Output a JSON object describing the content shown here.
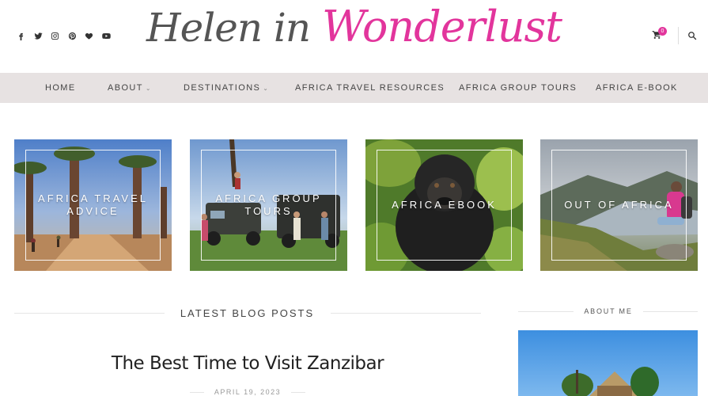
{
  "header": {
    "social": [
      {
        "icon": "facebook-icon"
      },
      {
        "icon": "twitter-icon"
      },
      {
        "icon": "instagram-icon"
      },
      {
        "icon": "pinterest-icon"
      },
      {
        "icon": "heart-icon"
      },
      {
        "icon": "youtube-icon"
      }
    ],
    "logo_part1": "Helen in ",
    "logo_part2": "Wonderlust",
    "cart_count": "0",
    "brand_color": "#e2359c"
  },
  "nav": {
    "items": [
      {
        "label": "HOME"
      },
      {
        "label": "ABOUT",
        "caret": "⌄"
      },
      {
        "label": "DESTINATIONS",
        "caret": "⌄"
      },
      {
        "label": "AFRICA TRAVEL RESOURCES"
      },
      {
        "label": "AFRICA GROUP TOURS"
      },
      {
        "label": "AFRICA E-BOOK"
      }
    ]
  },
  "features": [
    {
      "label": "AFRICA TRAVEL ADVICE"
    },
    {
      "label": "AFRICA GROUP TOURS"
    },
    {
      "label": "AFRICA EBOOK"
    },
    {
      "label": "OUT OF AFRICA"
    }
  ],
  "latest": {
    "section_title": "LATEST BLOG POSTS",
    "post_title": "The Best Time to Visit Zanzibar",
    "post_date": "APRIL 19, 2023"
  },
  "sidebar": {
    "about_title": "ABOUT ME"
  }
}
